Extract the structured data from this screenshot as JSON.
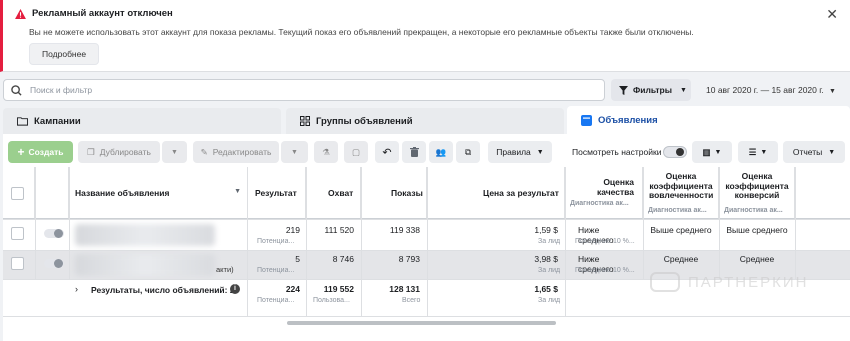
{
  "alert": {
    "title": "Рекламный аккаунт отключен",
    "text": "Вы не можете использовать этот аккаунт для показа рекламы. Текущий показ его объявлений прекращен, а некоторые его рекламные объекты также были отключены.",
    "button": "Подробнее",
    "close": "✕"
  },
  "search": {
    "placeholder": "Поиск и фильтр"
  },
  "filters_label": "Фильтры",
  "date_range": "10 авг 2020 г. — 15 авг 2020 г.",
  "tabs": [
    {
      "label": "Кампании",
      "icon": "folder-icon"
    },
    {
      "label": "Группы объявлений",
      "icon": "grid-icon"
    },
    {
      "label": "Объявления",
      "icon": "ad-icon"
    }
  ],
  "toolbar": {
    "create": "Создать",
    "duplicate": "Дублировать",
    "edit": "Редактировать",
    "rules": "Правила",
    "view_settings": "Посмотреть настройки",
    "reports": "Отчеты"
  },
  "columns": {
    "name": "Название объявления",
    "result": "Результат",
    "reach": "Охват",
    "impressions": "Показы",
    "cost_per_result": "Цена за результат",
    "quality": "Оценка качества",
    "quality_sub": "Диагностика ак...",
    "engagement": "Оценка коэффициента вовлеченности",
    "engagement_sub": "Диагностика ак...",
    "conversion": "Оценка коэффициента конверсий",
    "conversion_sub": "Диагностика ак..."
  },
  "rows": [
    {
      "name_suffix": "",
      "result": "219",
      "result_sub": "Потенциа...",
      "reach": "111 520",
      "impressions": "119 338",
      "cost": "1,59 $",
      "cost_sub": "За лид",
      "quality": "Ниже среднего",
      "quality_sub": "Последние 10 %...",
      "engagement": "Выше среднего",
      "conversion": "Выше среднего"
    },
    {
      "name_suffix": "акти)",
      "result": "5",
      "result_sub": "Потенциа...",
      "reach": "8 746",
      "impressions": "8 793",
      "cost": "3,98 $",
      "cost_sub": "За лид",
      "quality": "Ниже среднего",
      "quality_sub": "Последние 10 %...",
      "engagement": "Среднее",
      "conversion": "Среднее"
    }
  ],
  "totals": {
    "label": "Результаты, число объявлений: 2",
    "result": "224",
    "result_sub": "Потенциа...",
    "reach": "119 552",
    "reach_sub": "Пользова...",
    "impressions": "128 131",
    "impressions_sub": "Всего",
    "cost": "1,65 $",
    "cost_sub": "За лид"
  },
  "watermark": "ПАРТНЕРКИН",
  "colors": {
    "alert_red": "#e41e3f",
    "accent_blue": "#1877f2",
    "create_green": "#9bcf8e"
  }
}
